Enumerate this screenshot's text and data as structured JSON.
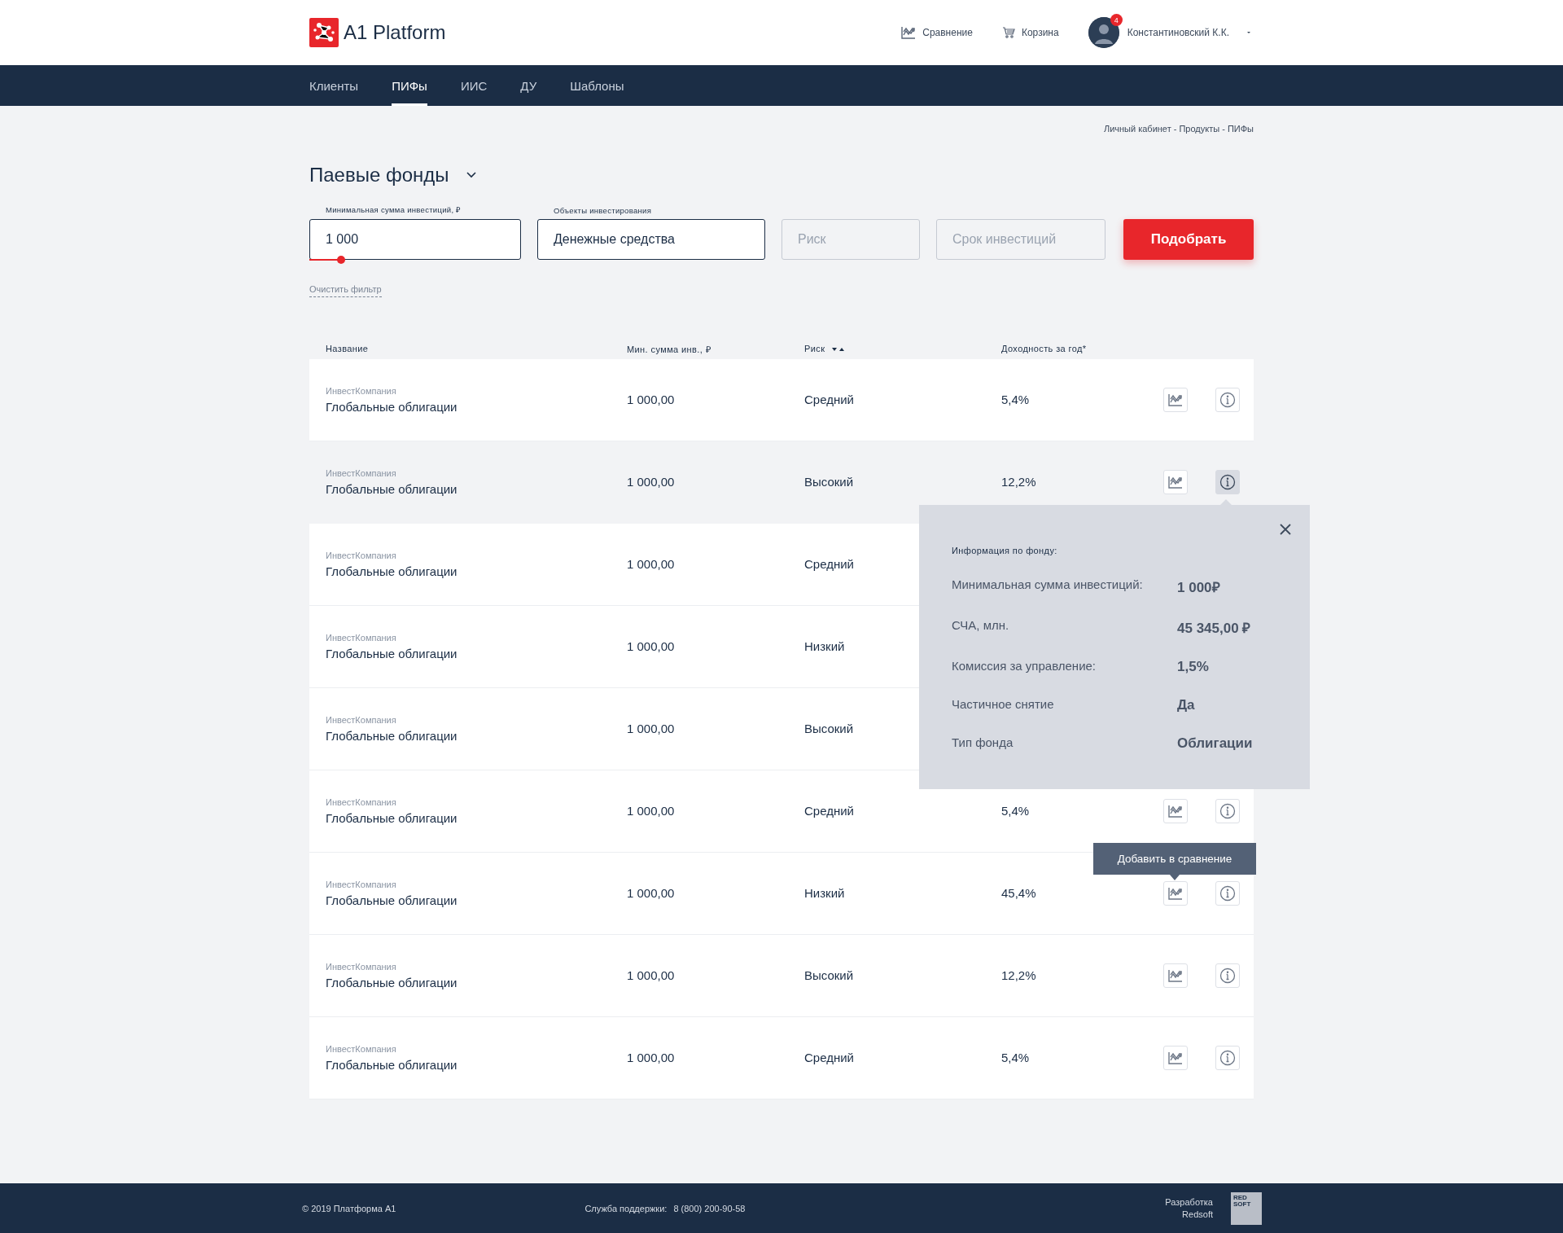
{
  "header": {
    "brand": "A1 Platform",
    "links": [
      {
        "kind": "compare",
        "label": "Сравнение"
      },
      {
        "kind": "cart",
        "label": "Корзина"
      }
    ],
    "user": {
      "name": "Константиновский К.К.",
      "badge": "4"
    }
  },
  "nav": [
    {
      "label": "Клиенты",
      "selected": false
    },
    {
      "label": "ПИФы",
      "selected": true
    },
    {
      "label": "ИИС",
      "selected": false
    },
    {
      "label": "ДУ",
      "selected": false
    },
    {
      "label": "Шаблоны",
      "selected": false
    }
  ],
  "breadcrumb": "Личный кабинет - Продукты - ПИФы",
  "title": "Паевые фонды",
  "filters": [
    {
      "label": "Минимальная сумма инвестиций, ₽",
      "value": "1 000",
      "level": 0.15
    },
    {
      "label": "Объекты инвестирования",
      "value": "Денежные средства"
    },
    {
      "placeholder": "Риск"
    },
    {
      "placeholder": "Срок инвестиций"
    }
  ],
  "submit": "Подобрать",
  "clear": "Очистить фильтр",
  "table": {
    "columns": [
      "Название",
      "Мин. сумма инв., ₽",
      "Риск",
      "Доходность за год*"
    ],
    "rows": [
      {
        "company": "ИнвестКомпания",
        "name": "Глобальные облигации",
        "min_sum": "1 000,00",
        "risk": "Средний",
        "yield": "5,4%",
        "selected": false,
        "actions": true,
        "info_open": false
      },
      {
        "company": "ИнвестКомпания",
        "name": "Глобальные облигации",
        "min_sum": "1 000,00",
        "risk": "Высокий",
        "yield": "12,2%",
        "selected": true,
        "actions": true,
        "info_open": true
      },
      {
        "company": "ИнвестКомпания",
        "name": "Глобальные облигации",
        "min_sum": "1 000,00",
        "risk": "Средний",
        "selected": false,
        "actions": false,
        "info_open": false
      },
      {
        "company": "ИнвестКомпания",
        "name": "Глобальные облигации",
        "min_sum": "1 000,00",
        "risk": "Низкий",
        "selected": false,
        "actions": false,
        "info_open": false
      },
      {
        "company": "ИнвестКомпания",
        "name": "Глобальные облигации",
        "min_sum": "1 000,00",
        "risk": "Высокий",
        "selected": false,
        "actions": false,
        "info_open": false
      },
      {
        "company": "ИнвестКомпания",
        "name": "Глобальные облигации",
        "min_sum": "1 000,00",
        "risk": "Средний",
        "yield": "5,4%",
        "selected": false,
        "actions": true,
        "info_open": false
      },
      {
        "company": "ИнвестКомпания",
        "name": "Глобальные облигации",
        "min_sum": "1 000,00",
        "risk": "Низкий",
        "yield": "45,4%",
        "selected": false,
        "actions": true,
        "info_open": false,
        "tooltip": "Добавить в сравнение"
      },
      {
        "company": "ИнвестКомпания",
        "name": "Глобальные облигации",
        "min_sum": "1 000,00",
        "risk": "Высокий",
        "yield": "12,2%",
        "selected": false,
        "actions": true,
        "info_open": false
      },
      {
        "company": "ИнвестКомпания",
        "name": "Глобальные облигации",
        "min_sum": "1 000,00",
        "risk": "Средний",
        "yield": "5,4%",
        "selected": false,
        "actions": true,
        "info_open": false
      }
    ]
  },
  "fund_info": {
    "title": "Информация по фонду:",
    "rows": [
      {
        "label": "Минимальная сумма инвестиций:",
        "value": "1 000₽"
      },
      {
        "label": "СЧА, млн.",
        "value": "45 345,00 ₽"
      },
      {
        "label": "Комиссия за управление:",
        "value": "1,5%"
      },
      {
        "label": "Частичное снятие",
        "value": "Да"
      },
      {
        "label": "Тип фонда",
        "value": "Облигации"
      }
    ]
  },
  "footer": {
    "copyright": "© 2019  Платформа А1",
    "support_label": "Служба поддержки:",
    "support_phone": "8 (800) 200-90-58",
    "dev_label": "Разработка",
    "dev_name": "Redsoft",
    "logo": [
      "RED",
      "SOFT"
    ]
  }
}
